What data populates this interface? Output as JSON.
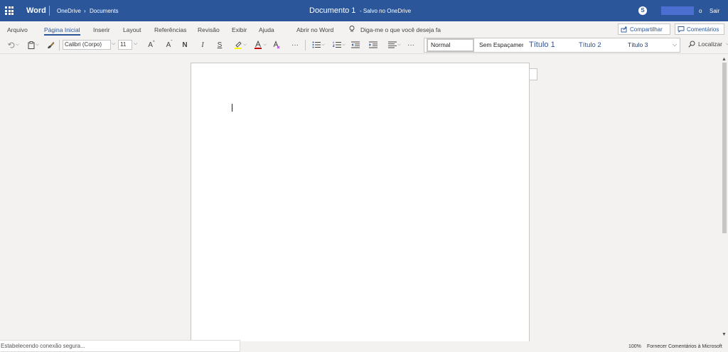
{
  "titlebar": {
    "app_name": "Word",
    "breadcrumb": [
      "OneDrive",
      "Documents"
    ],
    "breadcrumb_sep": "›",
    "doc_title": "Documento 1",
    "doc_status": "-   Salvo no OneDrive",
    "user_suffix": "o",
    "signout": "Sair",
    "skype_icon": "skype-icon"
  },
  "tabs": [
    {
      "label": "Arquivo"
    },
    {
      "label": "Página Inicial",
      "active": true
    },
    {
      "label": "Inserir"
    },
    {
      "label": "Layout"
    },
    {
      "label": "Referências"
    },
    {
      "label": "Revisão"
    },
    {
      "label": "Exibir"
    },
    {
      "label": "Ajuda"
    },
    {
      "label": "Abrir no Word"
    },
    {
      "label": "Diga-me o que você deseja fa"
    }
  ],
  "share_label": "Compartilhar",
  "comments_label": "Comentários",
  "toolbar": {
    "font_name": "Calibri (Corpo)",
    "font_size": "11",
    "grow_label": "A",
    "shrink_label": "A",
    "bold_label": "N",
    "italic_label": "I",
    "underline_label": "S",
    "more_label": "···"
  },
  "styles": [
    {
      "label": "Normal",
      "selected": true
    },
    {
      "label": "Sem Espaçamento"
    },
    {
      "label": "Título 1"
    },
    {
      "label": "Título 2"
    },
    {
      "label": "Título 3"
    }
  ],
  "find_label": "Localizar",
  "status": {
    "connection": "Estabelecendo conexão segura...",
    "zoom": "100%",
    "feedback": "Fornecer Comentários à Microsoft"
  },
  "colors": {
    "brand": "#2b579a",
    "highlight": "#ffff00",
    "font_color": "#c00000"
  }
}
